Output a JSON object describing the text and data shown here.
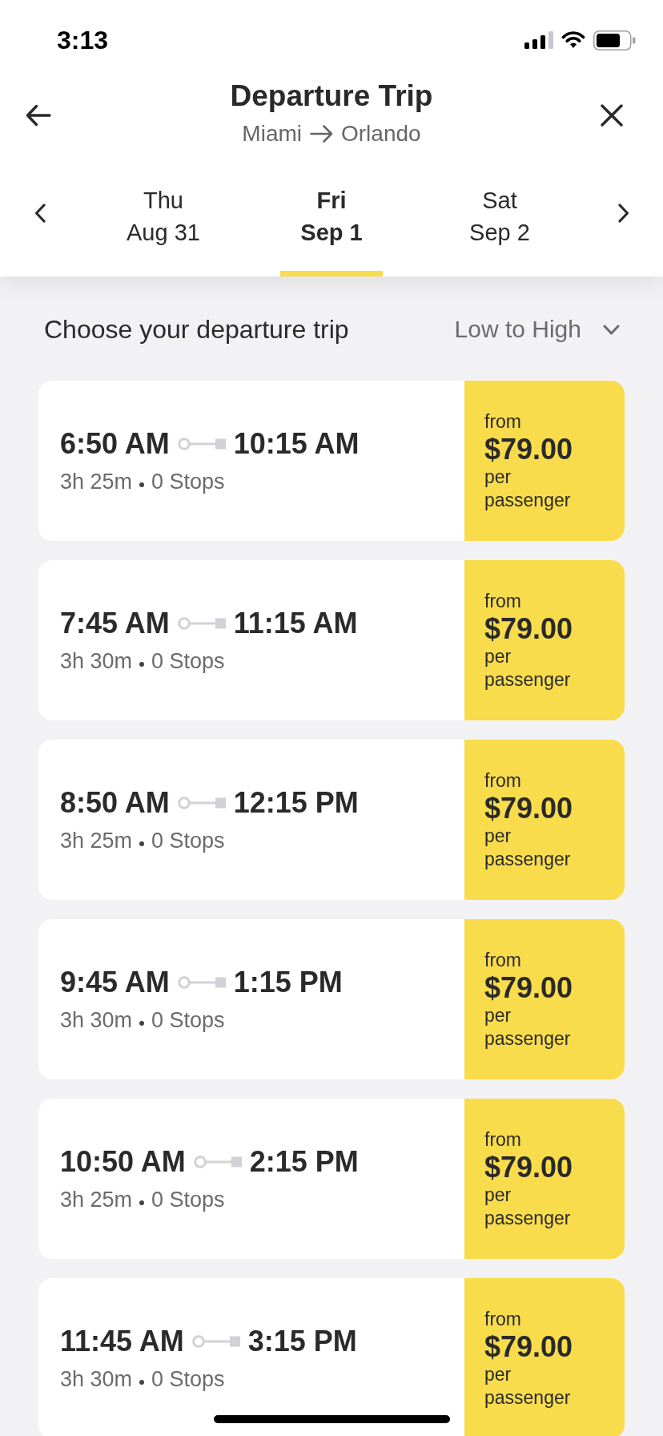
{
  "status_bar": {
    "time": "3:13"
  },
  "header": {
    "title": "Departure Trip",
    "origin": "Miami",
    "destination": "Orlando"
  },
  "date_tabs": [
    {
      "day": "Thu",
      "date": "Aug 31",
      "selected": false
    },
    {
      "day": "Fri",
      "date": "Sep 1",
      "selected": true
    },
    {
      "day": "Sat",
      "date": "Sep 2",
      "selected": false
    }
  ],
  "list_header": {
    "title": "Choose your departure trip",
    "sort": "Low to High"
  },
  "trips": [
    {
      "depart": "6:50 AM",
      "arrive": "10:15 AM",
      "duration": "3h 25m",
      "stops": "0 Stops",
      "price_prefix": "from",
      "price": "$79.00",
      "price_suffix": "per passenger"
    },
    {
      "depart": "7:45 AM",
      "arrive": "11:15 AM",
      "duration": "3h 30m",
      "stops": "0 Stops",
      "price_prefix": "from",
      "price": "$79.00",
      "price_suffix": "per passenger"
    },
    {
      "depart": "8:50 AM",
      "arrive": "12:15 PM",
      "duration": "3h 25m",
      "stops": "0 Stops",
      "price_prefix": "from",
      "price": "$79.00",
      "price_suffix": "per passenger"
    },
    {
      "depart": "9:45 AM",
      "arrive": "1:15 PM",
      "duration": "3h 30m",
      "stops": "0 Stops",
      "price_prefix": "from",
      "price": "$79.00",
      "price_suffix": "per passenger"
    },
    {
      "depart": "10:50 AM",
      "arrive": "2:15 PM",
      "duration": "3h 25m",
      "stops": "0 Stops",
      "price_prefix": "from",
      "price": "$79.00",
      "price_suffix": "per passenger"
    },
    {
      "depart": "11:45 AM",
      "arrive": "3:15 PM",
      "duration": "3h 30m",
      "stops": "0 Stops",
      "price_prefix": "from",
      "price": "$79.00",
      "price_suffix": "per passenger"
    }
  ]
}
